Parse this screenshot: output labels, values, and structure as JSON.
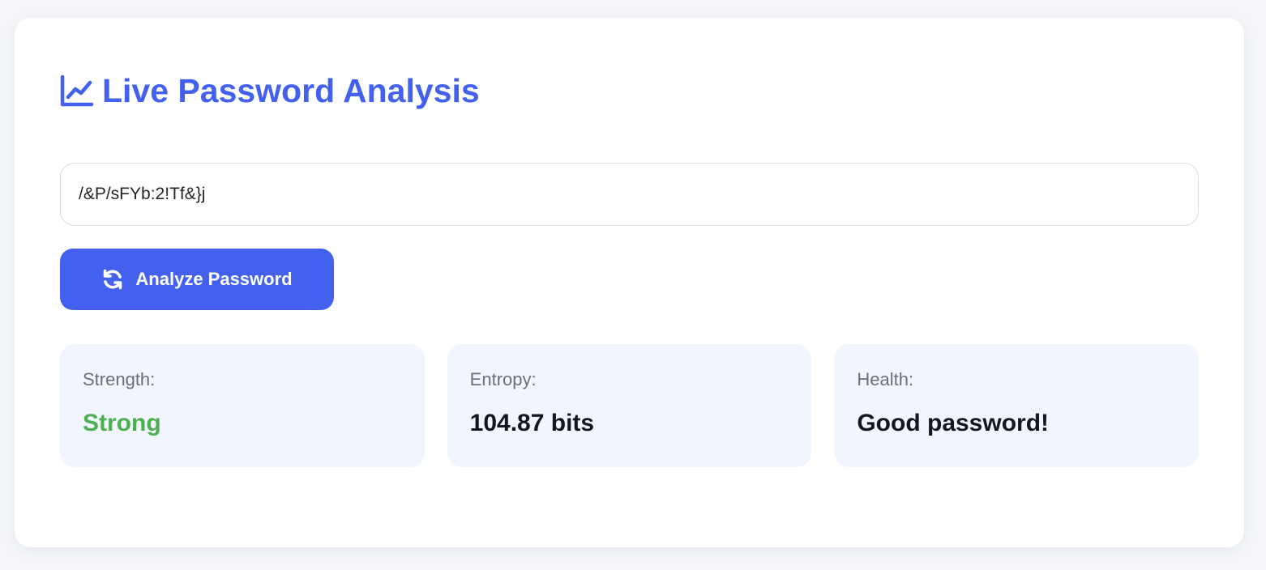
{
  "colors": {
    "accent": "#4361ee",
    "strong": "#4caf50",
    "stat_bg": "#f1f5fd",
    "text_dark": "#15171c"
  },
  "header": {
    "icon": "chart-line-icon",
    "title": "Live Password Analysis"
  },
  "password_field": {
    "value": "/&P/sFYb:2!Tf&}j"
  },
  "analyze_button": {
    "icon": "refresh-icon",
    "label": "Analyze Password"
  },
  "stats": {
    "strength": {
      "label": "Strength:",
      "value": "Strong"
    },
    "entropy": {
      "label": "Entropy:",
      "value": "104.87 bits"
    },
    "health": {
      "label": "Health:",
      "value": "Good password!"
    }
  }
}
